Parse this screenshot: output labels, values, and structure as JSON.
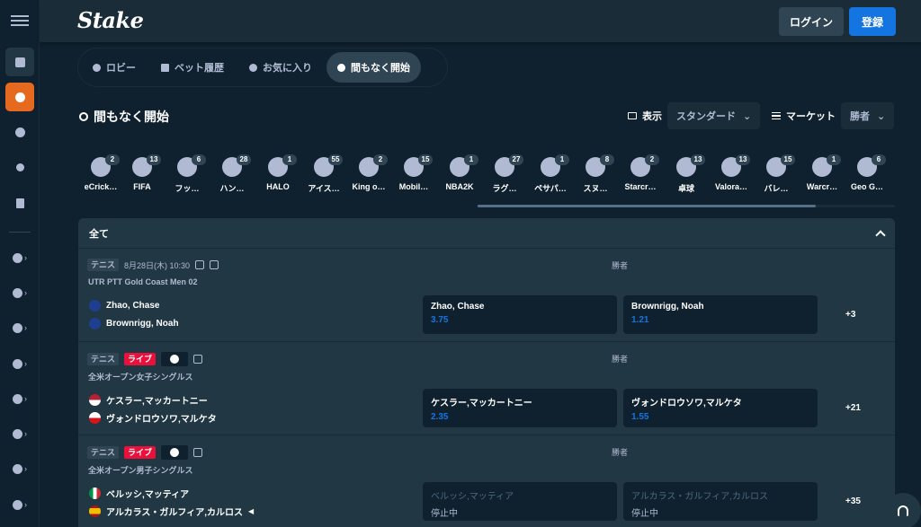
{
  "header": {
    "logo": "Stake",
    "login": "ログイン",
    "register": "登録"
  },
  "tabs": [
    {
      "label": "ロビー",
      "active": false
    },
    {
      "label": "ベット履歴",
      "active": false
    },
    {
      "label": "お気に入り",
      "active": false
    },
    {
      "label": "間もなく開始",
      "active": true
    }
  ],
  "section": {
    "title": "間もなく開始",
    "view_label": "表示",
    "view_value": "スタンダード",
    "market_label": "マーケット",
    "market_value": "勝者"
  },
  "sports": [
    {
      "name": "eCrick…",
      "count": "2"
    },
    {
      "name": "FIFA",
      "count": "13"
    },
    {
      "name": "フッ…",
      "count": "6"
    },
    {
      "name": "ハン…",
      "count": "28"
    },
    {
      "name": "HALO",
      "count": "1"
    },
    {
      "name": "アイス…",
      "count": "55"
    },
    {
      "name": "King o…",
      "count": "2"
    },
    {
      "name": "Mobil…",
      "count": "15"
    },
    {
      "name": "NBA2K",
      "count": "1"
    },
    {
      "name": "ラグ…",
      "count": "27"
    },
    {
      "name": "ペサパ…",
      "count": "1"
    },
    {
      "name": "スヌ…",
      "count": "8"
    },
    {
      "name": "Starcr…",
      "count": "2"
    },
    {
      "name": "卓球",
      "count": "13"
    },
    {
      "name": "Valora…",
      "count": "13"
    },
    {
      "name": "バレ…",
      "count": "15"
    },
    {
      "name": "Warcr…",
      "count": "1"
    },
    {
      "name": "Geo G…",
      "count": "6"
    }
  ],
  "panel": {
    "title": "全て"
  },
  "events": [
    {
      "sport": "テニス",
      "live": "",
      "date": "8月28日(木) 10:30",
      "league": "UTR PTT Gold Coast Men 02",
      "market": "勝者",
      "p1": "Zhao, Chase",
      "p2": "Brownrigg, Noah",
      "o1_name": "Zhao, Chase",
      "o1_val": "3.75",
      "o2_name": "Brownrigg, Noah",
      "o2_val": "1.21",
      "more": "+3"
    },
    {
      "sport": "テニス",
      "live": "ライブ",
      "date": "",
      "league": "全米オープン女子シングルス",
      "market": "勝者",
      "p1": "ケスラー,マッカートニー",
      "p2": "ヴォンドロウソワ,マルケタ",
      "o1_name": "ケスラー,マッカートニー",
      "o1_val": "2.35",
      "o2_name": "ヴォンドロウソワ,マルケタ",
      "o2_val": "1.55",
      "more": "+21"
    },
    {
      "sport": "テニス",
      "live": "ライブ",
      "date": "",
      "league": "全米オープン男子シングルス",
      "market": "勝者",
      "p1": "ベルッシ,マッティア",
      "p2": "アルカラス・ガルフィア,カルロス",
      "o1_name": "ベルッシ,マッティア",
      "o1_val": "停止中",
      "o2_name": "アルカラス・ガルフィア,カルロス",
      "o2_val": "停止中",
      "more": "+35"
    }
  ],
  "colors": {
    "bg": "#0f212e",
    "panel": "#213743",
    "accent": "#1475e1",
    "casino": "#e5691f",
    "live": "#e9113c"
  }
}
